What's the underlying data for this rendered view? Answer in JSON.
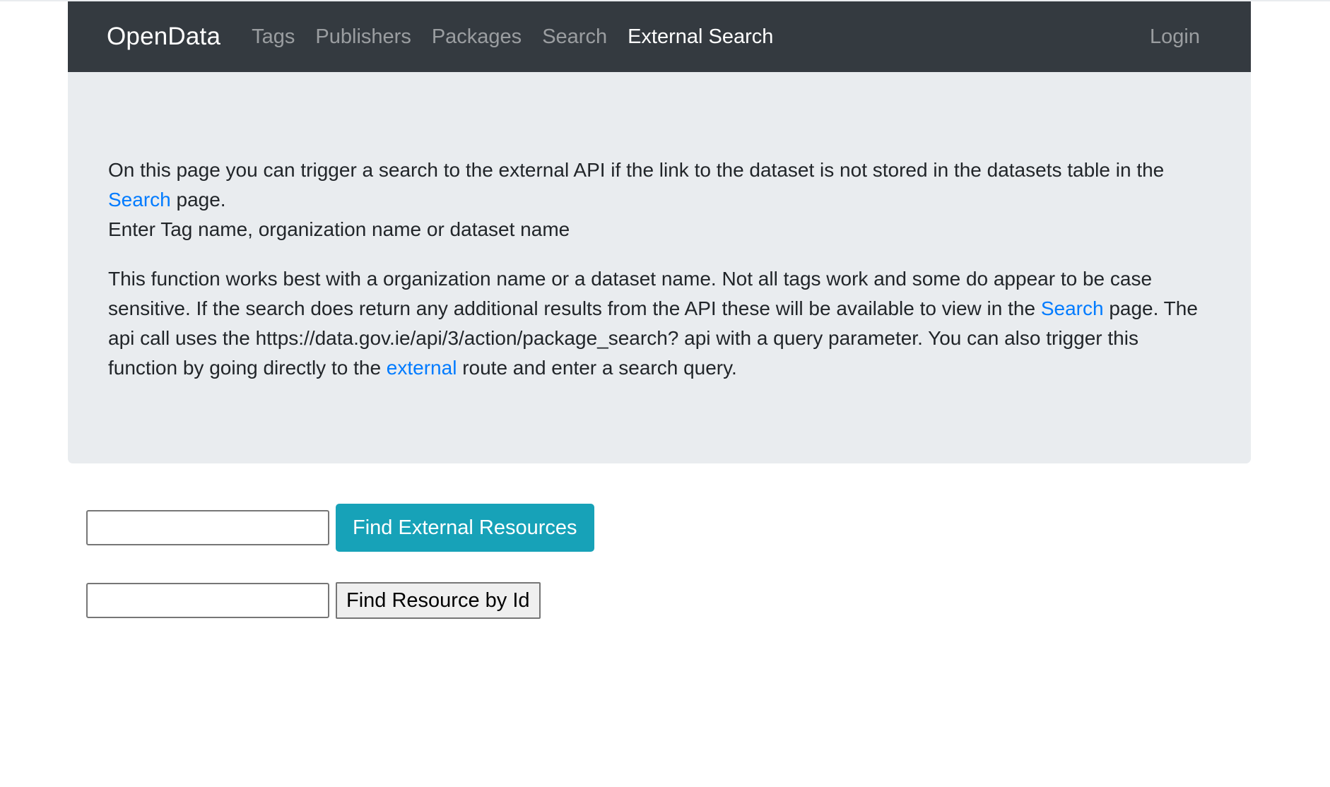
{
  "nav": {
    "brand": "OpenData",
    "items": [
      {
        "label": "Tags",
        "active": false
      },
      {
        "label": "Publishers",
        "active": false
      },
      {
        "label": "Packages",
        "active": false
      },
      {
        "label": "Search",
        "active": false
      },
      {
        "label": "External Search",
        "active": true
      }
    ],
    "login": "Login"
  },
  "intro": {
    "p1_text_a": "On this page you can trigger a search to the external API if the link to the dataset is not stored in the datasets table in the ",
    "p1_link": "Search",
    "p1_text_b": " page.",
    "p1_line2": "Enter Tag name, organization name or dataset name",
    "p2_text_a": "This function works best with a organization name or a dataset name. Not all tags work and some do appear to be case sensitive. If the search does return any additional results from the API these will be available to view in the ",
    "p2_link1": "Search",
    "p2_text_b": " page. The api call uses the https://data.gov.ie/api/3/action/package_search? api with a query parameter. You can also trigger this function by going directly to the ",
    "p2_link2": "external",
    "p2_text_c": " route and enter a search query."
  },
  "external_form": {
    "value": "",
    "button": "Find External Resources"
  },
  "id_form": {
    "value": "",
    "button": "Find Resource by Id"
  },
  "colors": {
    "navbar": "#343a40",
    "jumbotron": "#e9ecef",
    "link": "#007bff",
    "info_button": "#17a2b8"
  }
}
